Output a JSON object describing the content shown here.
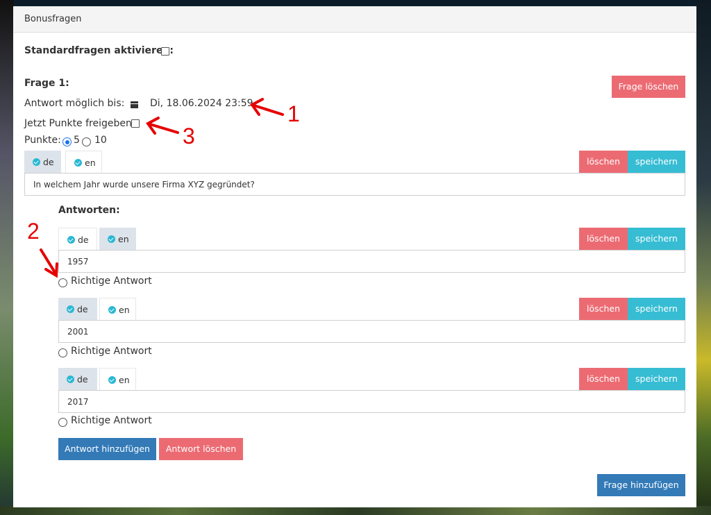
{
  "panel": {
    "title": "Bonusfragen"
  },
  "standard": {
    "label": "Standardfragen aktivieren:"
  },
  "question": {
    "title": "Frage 1:",
    "delete_label": "Frage löschen",
    "deadline_label": "Antwort möglich bis:",
    "deadline_value": "Di, 18.06.2024 23:59",
    "release_label": "Jetzt Punkte freigeben:",
    "points_label": "Punkte:",
    "points_options": [
      "5",
      "10"
    ],
    "points_selected": "5",
    "tabs": [
      "de",
      "en"
    ],
    "active_tab": "de",
    "text": "In welchem Jahr wurde unsere Firma XYZ gegründet?",
    "delete_btn": "löschen",
    "save_btn": "speichern"
  },
  "answers": {
    "heading": "Antworten:",
    "correct_label": "Richtige Antwort",
    "items": [
      {
        "tabs": [
          "de",
          "en"
        ],
        "active_tab": "en",
        "value": "1957",
        "delete_btn": "löschen",
        "save_btn": "speichern"
      },
      {
        "tabs": [
          "de",
          "en"
        ],
        "active_tab": "de",
        "value": "2001",
        "delete_btn": "löschen",
        "save_btn": "speichern"
      },
      {
        "tabs": [
          "de",
          "en"
        ],
        "active_tab": "de",
        "value": "2017",
        "delete_btn": "löschen",
        "save_btn": "speichern"
      }
    ],
    "add_btn": "Antwort hinzufügen",
    "remove_btn": "Antwort löschen"
  },
  "add_question_btn": "Frage hinzufügen",
  "annotations": [
    "1",
    "2",
    "3"
  ],
  "colors": {
    "red": "#ec6b73",
    "teal": "#36bdd3",
    "blue": "#337ab7",
    "annotation": "#e60000"
  },
  "icons": [
    "calendar-icon",
    "check-circle-icon",
    "arrow-icon"
  ]
}
